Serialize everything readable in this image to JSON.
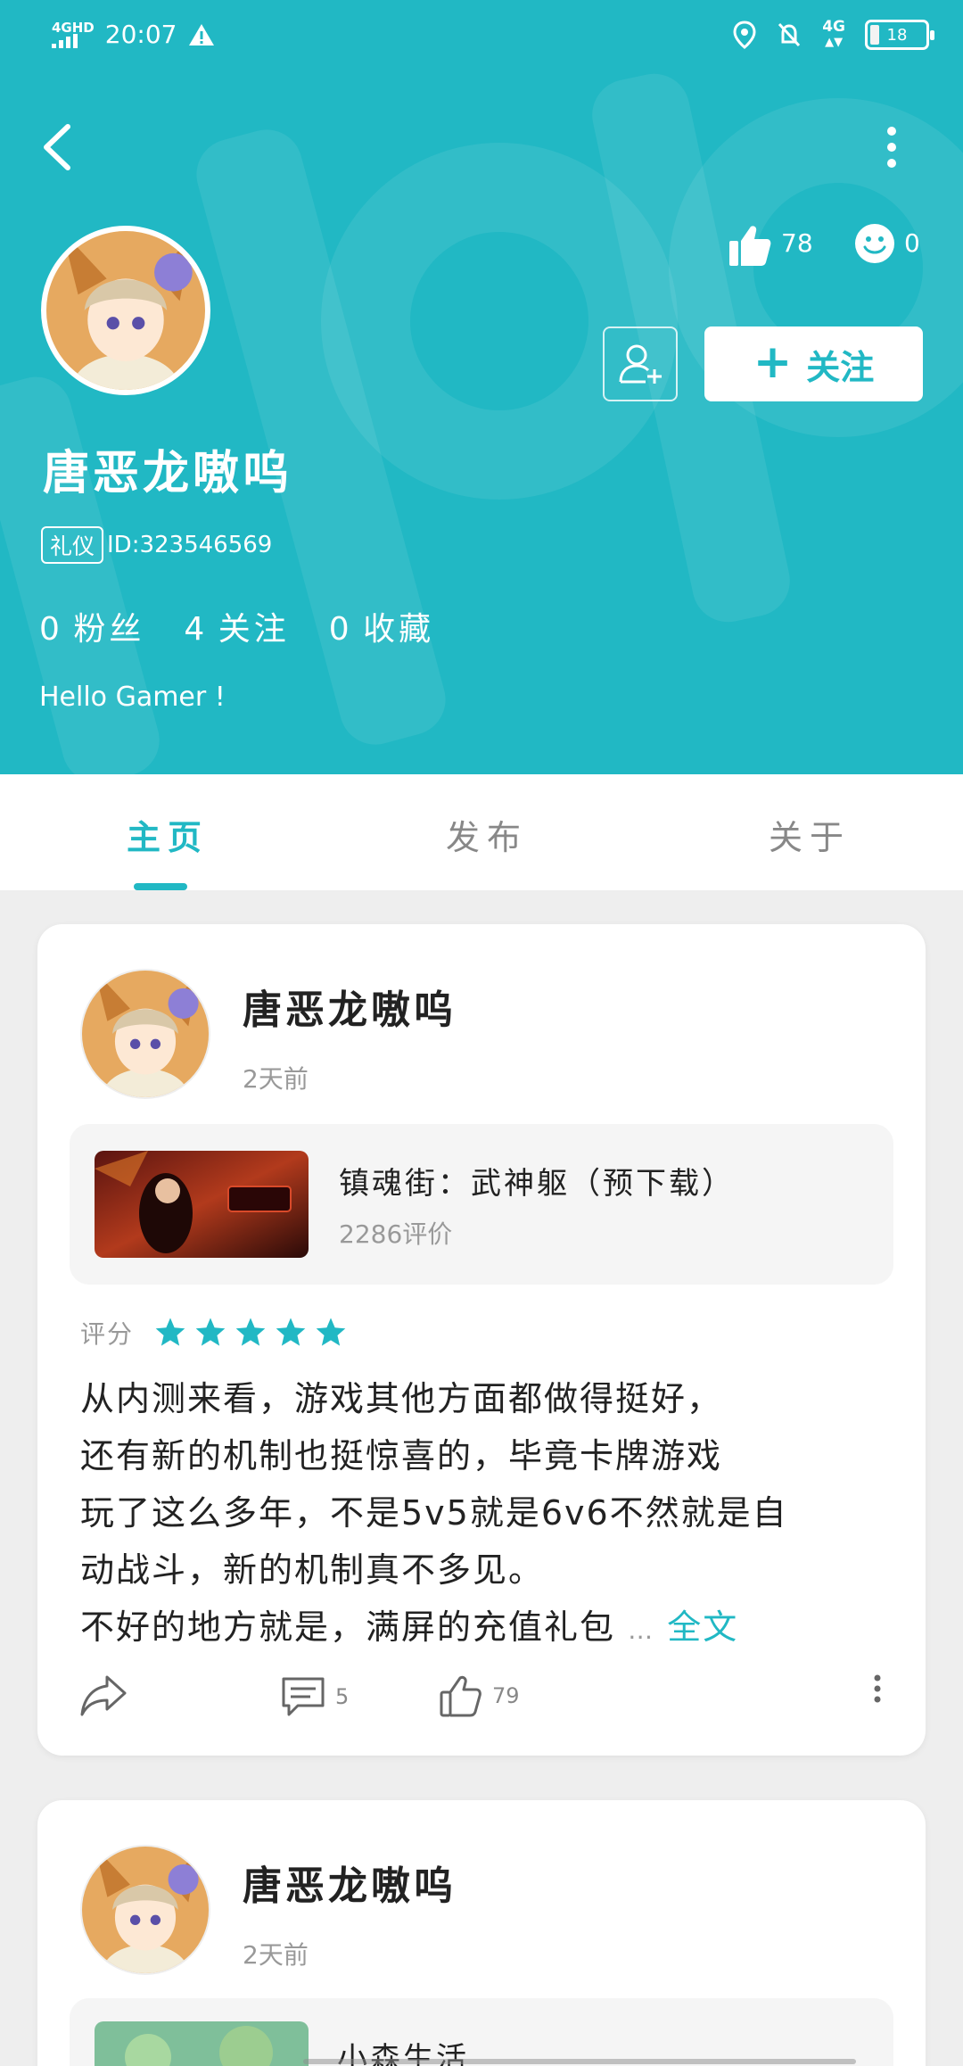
{
  "status_bar": {
    "network": "4GHD",
    "time": "20:07",
    "network_right": "4G",
    "battery": "18"
  },
  "profile": {
    "username": "唐恶龙嗷呜",
    "badge": "礼仪",
    "id_text": "ID:323546569",
    "likes": "78",
    "reactions": "0",
    "follow_label": "关注",
    "fans_count": "0",
    "fans_label": "粉丝",
    "following_count": "4",
    "following_label": "关注",
    "favorites_count": "0",
    "favorites_label": "收藏",
    "bio": "Hello Gamer !"
  },
  "tabs": [
    {
      "label": "主页",
      "active": true
    },
    {
      "label": "发布",
      "active": false
    },
    {
      "label": "关于",
      "active": false
    }
  ],
  "posts": [
    {
      "author": "唐恶龙嗷呜",
      "time": "2天前",
      "game_title": "镇魂街：武神躯（预下载）",
      "game_reviews": "2286评价",
      "rating_label": "评分",
      "rating": 5,
      "review_lines": [
        "从内测来看，游戏其他方面都做得挺好，",
        "还有新的机制也挺惊喜的，毕竟卡牌游戏",
        "玩了这么多年，不是5v5就是6v6不然就是自",
        "动战斗，新的机制真不多见。"
      ],
      "review_last": "不好的地方就是，满屏的充值礼包",
      "ellipsis": "…",
      "more_label": "全文",
      "comments": "5",
      "likes": "79"
    },
    {
      "author": "唐恶龙嗷呜",
      "time": "2天前",
      "game_title": "小森生活"
    }
  ],
  "colors": {
    "accent": "#21b8c4",
    "star": "#21b8c4",
    "text_gray": "#999999"
  }
}
